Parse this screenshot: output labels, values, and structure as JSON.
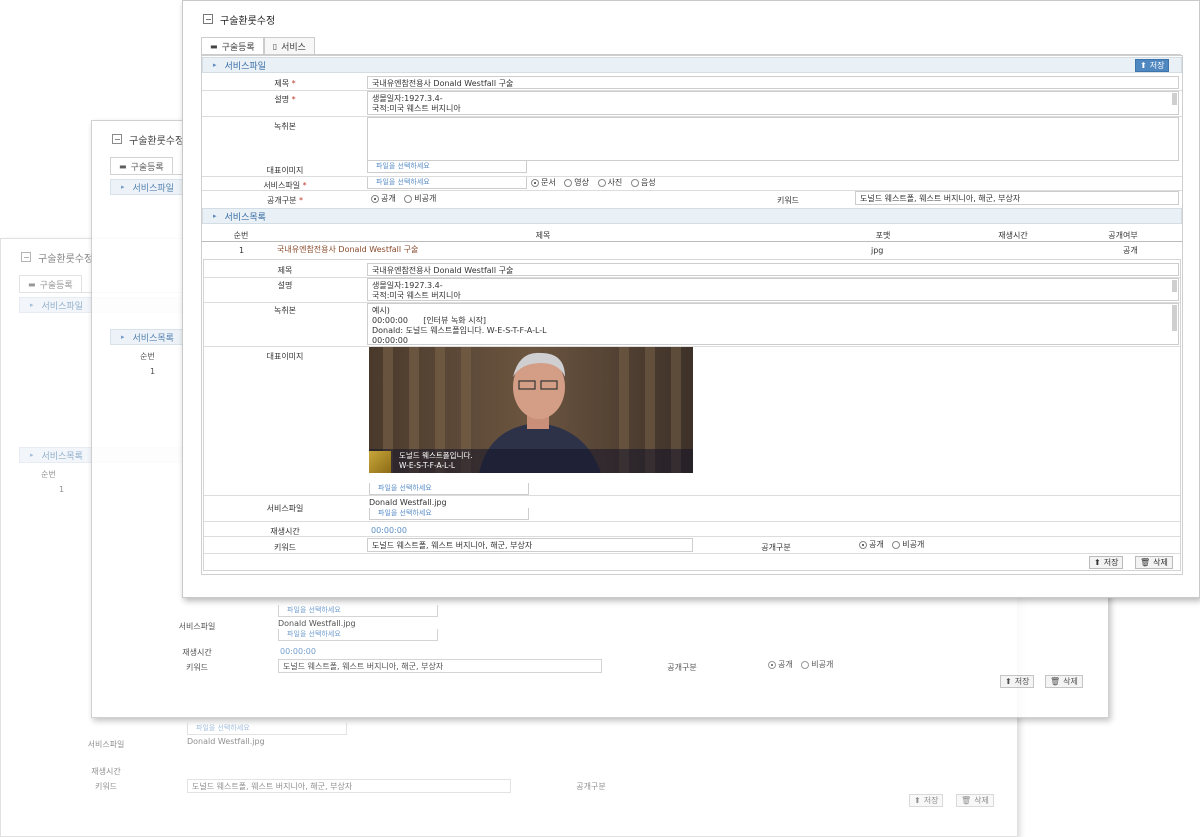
{
  "page_title": "구술환룻수정",
  "tabs": [
    {
      "label": "구술등록",
      "icon": "list-icon"
    },
    {
      "label": "서비스",
      "icon": "document-icon"
    }
  ],
  "service_file_section": {
    "title": "서비스파일",
    "save_label": "저장",
    "labels": {
      "title": "제목",
      "description": "설명",
      "transcript": "녹취본",
      "rep_image": "대표이미지",
      "service_file": "서비스파일",
      "public": "공개구분",
      "keyword": "키워드",
      "required_mark": "*"
    },
    "title_value": "국내유엔참전용사 Donald Westfall 구술",
    "description_line1": "생몰일자:1927.3.4-",
    "description_line2": "국적:미국 웨스트 버지니아",
    "rep_image_file": "파일을 선택하세요",
    "service_file_file": "파일을 선택하세요",
    "file_type_options": [
      "문서",
      "영상",
      "사진",
      "음성"
    ],
    "file_type_selected": "문서",
    "public_options": [
      "공개",
      "비공개"
    ],
    "public_selected": "공개",
    "keyword_value": "도널드 웨스트폴, 웨스트 버지니아, 해군, 부상자"
  },
  "service_list_section": {
    "title": "서비스목록",
    "columns": [
      "순번",
      "제목",
      "포맷",
      "재생시간",
      "공개여부"
    ],
    "row": {
      "index": "1",
      "title": "국내유엔참전용사 Donald Westfall 구술",
      "format": "jpg",
      "duration": "",
      "public": "공개"
    }
  },
  "detail": {
    "labels": {
      "title": "제목",
      "description": "설명",
      "transcript": "녹취본",
      "rep_image": "대표이미지",
      "service_file": "서비스파일",
      "duration": "재생시간",
      "keyword": "키워드",
      "public": "공개구분"
    },
    "title_value": "국내유엔참전용사 Donald Westfall 구술",
    "description_line1": "생몰일자:1927.3.4-",
    "description_line2": "국적:미국 웨스트 버지니아",
    "transcript_line1": "예시)",
    "transcript_line2_time": "00:00:00",
    "transcript_line2_text": "[인터뷰 녹화 시작]",
    "transcript_line3": "Donald: 도널드 웨스트폴입니다. W-E-S-T-F-A-L-L",
    "transcript_line4": "00:00:00",
    "photo_caption_line1": "도널드 웨스트폴입니다.",
    "photo_caption_line2": "W-E-S-T-F-A-L-L",
    "rep_image_file": "파일을 선택하세요",
    "service_file_name": "Donald Westfall.jpg",
    "service_file_file": "파일을 선택하세요",
    "duration_value": "00:00:00",
    "keyword_value": "도널드 웨스트폴, 웨스트 버지니아, 해군, 부상자",
    "public_options": [
      "공개",
      "비공개"
    ],
    "public_selected": "공개",
    "edit_label": "저장",
    "delete_label": "삭제"
  },
  "colors": {
    "section_bg": "#e9f0f6",
    "section_text": "#3a6ea5",
    "save_button": "#4f87c0",
    "required": "#c0392b",
    "file_link": "#5b8fc7"
  }
}
